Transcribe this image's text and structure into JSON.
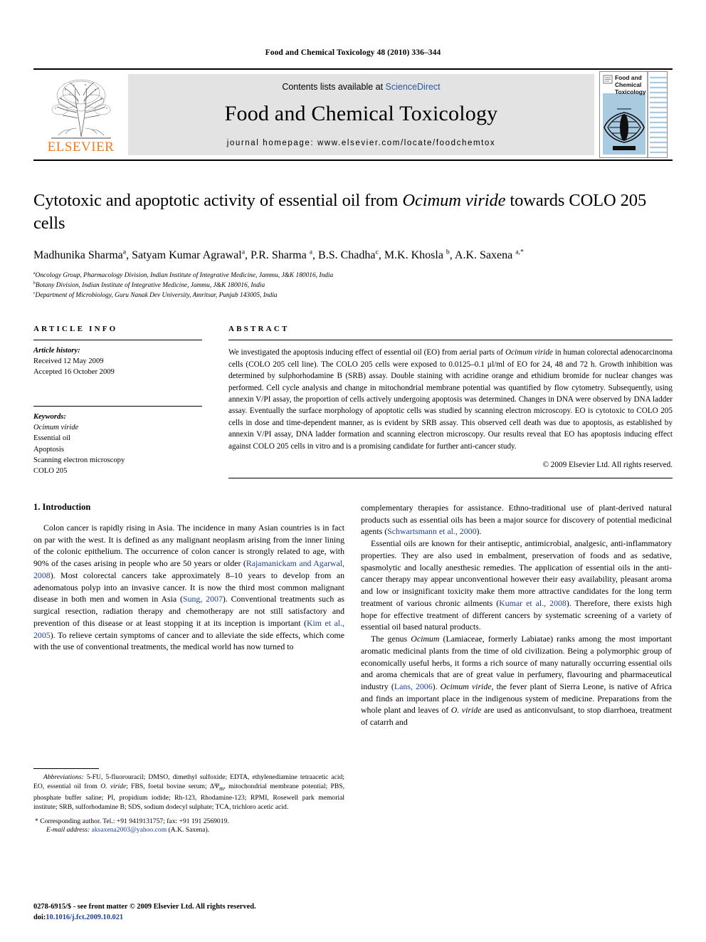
{
  "running_head": "Food and Chemical Toxicology 48 (2010) 336–344",
  "masthead": {
    "publisher_name": "ELSEVIER",
    "contents_prefix": "Contents lists available at ",
    "sciencedirect": "ScienceDirect",
    "journal_name": "Food and Chemical Toxicology",
    "homepage": "journal homepage: www.elsevier.com/locate/foodchemtox",
    "cover_title_lines": [
      "Food and",
      "Chemical",
      "Toxicology"
    ]
  },
  "article": {
    "title": "Cytotoxic and apoptotic activity of essential oil from Ocimum viride towards COLO 205 cells",
    "title_part1": "Cytotoxic and apoptotic activity of essential oil from ",
    "title_italic": "Ocimum viride",
    "title_part2": " towards COLO 205 cells",
    "authors": "Madhunika Sharma a, Satyam Kumar Agrawal a, P.R. Sharma a, B.S. Chadha c, M.K. Khosla b, A.K. Saxena a,*",
    "affiliations": [
      "Oncology Group, Pharmacology Division, Indian Institute of Integrative Medicine, Jammu, J&K 180016, India",
      "Botany Division, Indian Institute of Integrative Medicine, Jammu, J&K 180016, India",
      "Department of Microbiology, Guru Nanak Dev University, Amritsar, Punjab 143005, India"
    ],
    "affiliation_markers": [
      "a",
      "b",
      "c"
    ]
  },
  "article_info": {
    "heading": "ARTICLE INFO",
    "history_label": "Article history:",
    "history": [
      "Received 12 May 2009",
      "Accepted 16 October 2009"
    ],
    "keywords_label": "Keywords:",
    "keywords": [
      "Ocimum viride",
      "Essential oil",
      "Apoptosis",
      "Scanning electron microscopy",
      "COLO 205"
    ],
    "keyword_italic_index": 0
  },
  "abstract": {
    "heading": "ABSTRACT",
    "paragraph_pre_italic": "We investigated the apoptosis inducing effect of essential oil (EO) from aerial parts of ",
    "italic_term": "Ocimum viride",
    "paragraph_post_italic": " in human colorectal adenocarcinoma cells (COLO 205 cell line). The COLO 205 cells were exposed to 0.0125–0.1 µl/ml of EO for 24, 48 and 72 h. Growth inhibition was determined by sulphorhodamine B (SRB) assay. Double staining with acridine orange and ethidium bromide for nuclear changes was performed. Cell cycle analysis and change in mitochondrial membrane potential was quantified by flow cytometry. Subsequently, using annexin V/PI assay, the proportion of cells actively undergoing apoptosis was determined. Changes in DNA were observed by DNA ladder assay. Eventually the surface morphology of apoptotic cells was studied by scanning electron microscopy. EO is cytotoxic to COLO 205 cells in dose and time-dependent manner, as is evident by SRB assay. This observed cell death was due to apoptosis, as established by annexin V/PI assay, DNA ladder formation and scanning electron microscopy. Our results reveal that EO has apoptosis inducing effect against COLO 205 cells in vitro and is a promising candidate for further anti-cancer study.",
    "copyright": "© 2009 Elsevier Ltd. All rights reserved."
  },
  "introduction": {
    "heading": "1. Introduction",
    "left_p1_a": "Colon cancer is rapidly rising in Asia. The incidence in many Asian countries is in fact on par with the west. It is defined as any malignant neoplasm arising from the inner lining of the colonic epithelium. The occurrence of colon cancer is strongly related to age, with 90% of the cases arising in people who are 50 years or older (",
    "left_cite1": "Rajamanickam and Agarwal, 2008",
    "left_p1_b": "). Most colorectal cancers take approximately 8–10 years to develop from an adenomatous polyp into an invasive cancer. It is now the third most common malignant disease in both men and women in Asia (",
    "left_cite2": "Sung, 2007",
    "left_p1_c": "). Conventional treatments such as surgical resection, radiation therapy and chemotherapy are not still satisfactory and prevention of this disease or at least stopping it at its inception is important (",
    "left_cite3": "Kim et al., 2005",
    "left_p1_d": "). To relieve certain symptoms of cancer and to alleviate the side effects, which come with the use of conventional treatments, the medical world has now turned to",
    "right_p1_a": "complementary therapies for assistance. Ethno-traditional use of plant-derived natural products such as essential oils has been a major source for discovery of potential medicinal agents (",
    "right_cite1": "Schwartsmann et al., 2000",
    "right_p1_b": ").",
    "right_p2_a": "Essential oils are known for their antiseptic, antimicrobial, analgesic, anti-inflammatory properties. They are also used in embalment, preservation of foods and as sedative, spasmolytic and locally anesthesic remedies. The application of essential oils in the anti-cancer therapy may appear unconventional however their easy availability, pleasant aroma and low or insignificant toxicity make them more attractive candidates for the long term treatment of various chronic ailments (",
    "right_cite2": "Kumar et al., 2008",
    "right_p2_b": "). Therefore, there exists high hope for effective treatment of different cancers by systematic screening of a variety of essential oil based natural products.",
    "right_p3_a": "The genus ",
    "right_p3_italic1": "Ocimum",
    "right_p3_b": " (Lamiaceae, formerly Labiatae) ranks among the most important aromatic medicinal plants from the time of old civilization. Being a polymorphic group of economically useful herbs, it forms a rich source of many naturally occurring essential oils and aroma chemicals that are of great value in perfumery, flavouring and pharmaceutical industry (",
    "right_cite3": "Lans, 2006",
    "right_p3_c": "). ",
    "right_p3_italic2": "Ocimum viride",
    "right_p3_d": ", the fever plant of Sierra Leone, is native of Africa and finds an important place in the indigenous system of medicine. Preparations from the whole plant and leaves of ",
    "right_p3_italic3": "O. viride",
    "right_p3_e": " are used as anticonvulsant, to stop diarrhoea, treatment of catarrh and"
  },
  "footnote": {
    "abbrev_label": "Abbreviations:",
    "abbrev_a": " 5-FU, 5-fluorouracil; DMSO, dimethyl sulfoxide; EDTA, ethylenediamine tetraacetic acid; EO, essential oil from ",
    "abbrev_italic": "O. viride",
    "abbrev_b": "; FBS, foetal bovine serum; ΔΨ",
    "abbrev_sub": "m",
    "abbrev_c": ", mitochondrial membrane potential; PBS, phosphate buffer saline; PI, propidium iodide; Rh-123, Rhodamine-123; RPMI, Rosewell park memorial institute; SRB, sulforhodamine B; SDS, sodium dodecyl sulphate; TCA, trichloro acetic acid.",
    "corresponding": "Corresponding author. Tel.: +91 9419131757; fax: +91 191 2569019.",
    "email_label": "E-mail address:",
    "email": "aksaxena2003@yahoo.com",
    "email_suffix": " (A.K. Saxena)."
  },
  "footer": {
    "issn_line": "0278-6915/$ - see front matter © 2009 Elsevier Ltd. All rights reserved.",
    "doi_label": "doi:",
    "doi_value": "10.1016/j.fct.2009.10.021"
  },
  "colors": {
    "link_blue": "#1c3f94",
    "sciencedirect_blue": "#2a56a8",
    "elsevier_orange": "#ef7b23",
    "banner_grey": "#e3e3e3",
    "cover_blue": "#a8cbe2"
  }
}
